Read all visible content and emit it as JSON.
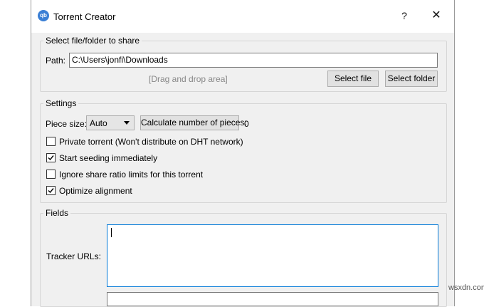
{
  "window": {
    "title": "Torrent Creator",
    "app_icon_text": "qb",
    "help_label": "?",
    "close_label": "✕"
  },
  "share_group": {
    "title": "Select file/folder to share",
    "path_label": "Path:",
    "path_value": "C:\\Users\\jonfi\\Downloads",
    "drop_hint": "[Drag and drop area]",
    "select_file_label": "Select file",
    "select_folder_label": "Select folder"
  },
  "settings_group": {
    "title": "Settings",
    "piece_size_label": "Piece size:",
    "piece_size_value": "Auto",
    "calc_button_label": "Calculate number of pieces:",
    "pieces_count": "0",
    "checkboxes": [
      {
        "label": "Private torrent (Won't distribute on DHT network)",
        "checked": false
      },
      {
        "label": "Start seeding immediately",
        "checked": true
      },
      {
        "label": "Ignore share ratio limits for this torrent",
        "checked": false
      },
      {
        "label": "Optimize alignment",
        "checked": true
      }
    ]
  },
  "fields_group": {
    "title": "Fields",
    "tracker_urls_label": "Tracker URLs:",
    "tracker_urls_value": ""
  },
  "watermark": "wsxdn.com"
}
